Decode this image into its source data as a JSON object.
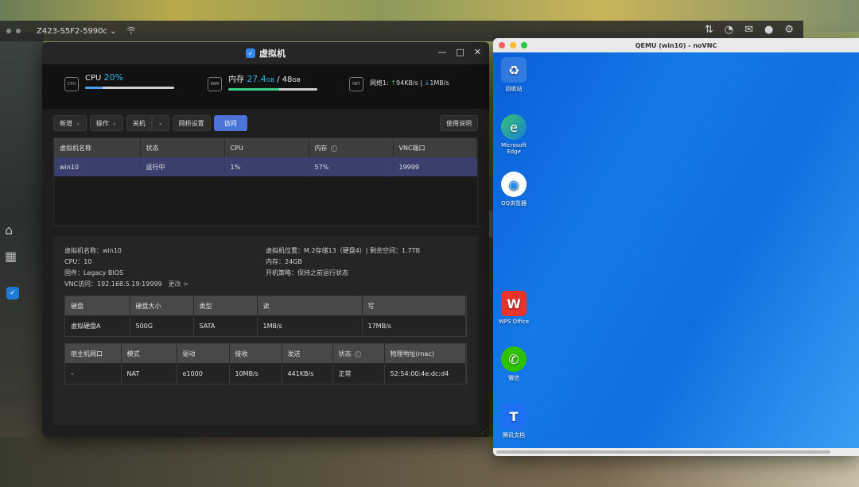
{
  "host": {
    "device_name": "Z423-S5F2-5990c",
    "chevron": "⌄"
  },
  "window": {
    "title": "虚拟机",
    "app_glyph": "✓"
  },
  "stats": {
    "cpu_label": "CPU",
    "cpu_value": "20%",
    "cpu_fraction": 0.2,
    "mem_label": "内存",
    "mem_used": "27.4",
    "mem_used_unit": "GB",
    "mem_sep": " / ",
    "mem_total": "48",
    "mem_total_unit": "GB",
    "mem_fraction": 0.57,
    "net_label": "网络1:",
    "net_up": "94KB/s",
    "net_sep": " | ",
    "net_down": "1MB/s",
    "cpu_chip": "CPU",
    "ram_chip": "RAM",
    "net_chip": "NET"
  },
  "toolbar": {
    "new": "新增",
    "ops": "操作",
    "shutdown": "关机",
    "bridge": "网桥设置",
    "visit": "访问",
    "help": "使用说明"
  },
  "vm_table": {
    "headers": [
      "虚拟机名称",
      "状态",
      "CPU",
      "内存",
      "VNC端口"
    ],
    "rows": [
      [
        "win10",
        "运行中",
        "1%",
        "57%",
        "19999"
      ]
    ]
  },
  "details": {
    "name": "虚拟机名称：win10",
    "cpu": "CPU：10",
    "firmware": "固件：Legacy BIOS",
    "vnc": "VNC访问：192.168.5.19:19999",
    "change": "更改 >",
    "location": "虚拟机位置：M.2存储13（硬盘4）| 剩余空间：1.7TB",
    "memory": "内存：24GB",
    "boot_policy": "开机策略：保持之前运行状态"
  },
  "disk_table": {
    "headers": [
      "硬盘",
      "硬盘大小",
      "类型",
      "读",
      "写"
    ],
    "rows": [
      [
        "虚拟硬盘A",
        "500G",
        "SATA",
        "1MB/s",
        "17MB/s"
      ]
    ]
  },
  "net_table": {
    "headers": [
      "宿主机网口",
      "模式",
      "驱动",
      "接收",
      "发送",
      "状态",
      "物理地址(mac)"
    ],
    "rows": [
      [
        "–",
        "NAT",
        "e1000",
        "10MB/s",
        "441KB/s",
        "正常",
        "52:54:00:4e:dc:d4"
      ]
    ]
  },
  "qemu": {
    "title": "QEMU (win10) - noVNC",
    "icons": [
      "回收站",
      "Microsoft Edge",
      "QQ浏览器",
      "WPS Office",
      "微信",
      "腾讯文档"
    ]
  },
  "colors": {
    "accent": "#38b4e8",
    "primary_button": "#4a74d8",
    "selected_row": "#3a3f6e",
    "cpu_bar": "#4aa0f0",
    "mem_bar": "#3ccf8a",
    "desktop_blue": "#1479e8"
  }
}
